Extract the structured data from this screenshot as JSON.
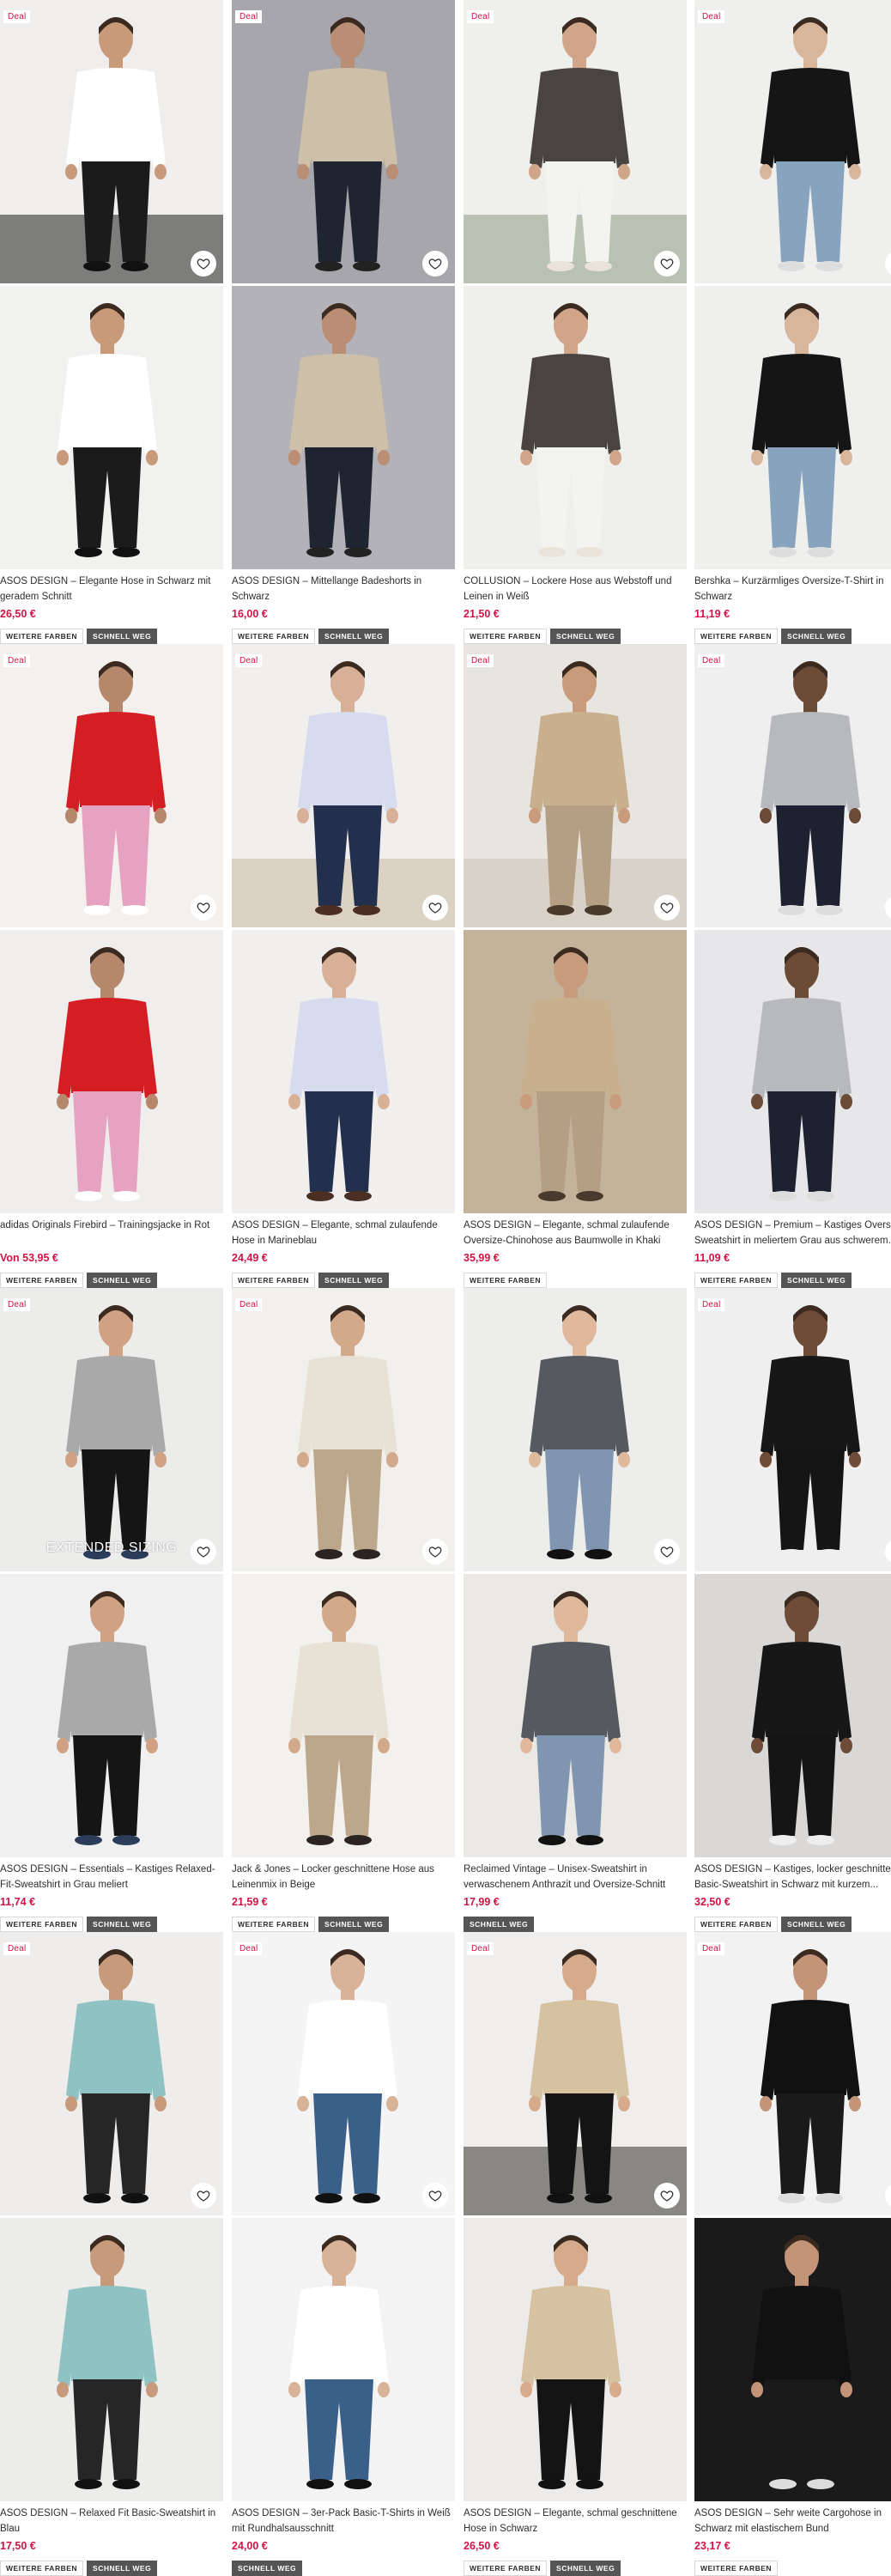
{
  "colors": {
    "deal": "#d01345",
    "price": "#d01345",
    "fast_tag_bg": "#555555"
  },
  "labels": {
    "deal": "Deal",
    "more_colors": "WEITERE FARBEN",
    "fast": "SCHNELL WEG",
    "extended_sizing": "EXTENDED SIZING"
  },
  "products": [
    {
      "name": "ASOS DESIGN – Elegante Hose in Schwarz mit geradem Schnitt",
      "price": "26,50 €",
      "deal": true,
      "more_colors": true,
      "fast": true
    },
    {
      "name": "ASOS DESIGN – Mittellange Badeshorts in Schwarz",
      "price": "16,00 €",
      "deal": true,
      "more_colors": true,
      "fast": true
    },
    {
      "name": "COLLUSION – Lockere Hose aus Webstoff und Leinen in Weiß",
      "price": "21,50 €",
      "deal": true,
      "more_colors": true,
      "fast": true
    },
    {
      "name": "Bershka – Kurzärmliges Oversize-T-Shirt in Schwarz",
      "price": "11,19 €",
      "deal": true,
      "more_colors": true,
      "fast": true
    },
    {
      "name": "adidas Originals Firebird – Trainingsjacke in Rot",
      "price": "Von 53,95 €",
      "deal": true,
      "more_colors": true,
      "fast": true
    },
    {
      "name": "ASOS DESIGN – Elegante, schmal zulaufende Hose in Marineblau",
      "price": "24,49 €",
      "deal": true,
      "more_colors": true,
      "fast": true
    },
    {
      "name": "ASOS DESIGN – Elegante, schmal zulaufende Oversize-Chinohose aus Baumwolle in Khaki",
      "price": "35,99 €",
      "deal": true,
      "more_colors": true,
      "fast": false
    },
    {
      "name": "ASOS DESIGN – Premium – Kastiges Oversize-Sweatshirt in meliertem Grau aus schwerem...",
      "price": "11,09 €",
      "deal": true,
      "more_colors": true,
      "fast": true
    },
    {
      "name": "ASOS DESIGN – Essentials – Kastiges Relaxed-Fit-Sweatshirt in Grau meliert",
      "price": "11,74 €",
      "deal": true,
      "more_colors": true,
      "fast": true,
      "extended": true
    },
    {
      "name": "Jack & Jones – Locker geschnittene Hose aus Leinenmix in Beige",
      "price": "21,59 €",
      "deal": true,
      "more_colors": true,
      "fast": true
    },
    {
      "name": "Reclaimed Vintage – Unisex-Sweatshirt in verwaschenem Anthrazit und Oversize-Schnitt",
      "price": "17,99 €",
      "deal": false,
      "more_colors": false,
      "fast": true
    },
    {
      "name": "ASOS DESIGN – Kastiges, locker geschnittenes Basic-Sweatshirt in Schwarz mit kurzem...",
      "price": "32,50 €",
      "deal": true,
      "more_colors": true,
      "fast": true
    },
    {
      "name": "ASOS DESIGN – Relaxed Fit Basic-Sweatshirt in Blau",
      "price": "17,50 €",
      "deal": true,
      "more_colors": true,
      "fast": true
    },
    {
      "name": "ASOS DESIGN – 3er-Pack Basic-T-Shirts in Weiß mit Rundhalsausschnitt",
      "price": "24,00 €",
      "deal": true,
      "more_colors": false,
      "fast": true
    },
    {
      "name": "ASOS DESIGN – Elegante, schmal geschnittene Hose in Schwarz",
      "price": "26,50 €",
      "deal": true,
      "more_colors": true,
      "fast": true
    },
    {
      "name": "ASOS DESIGN – Sehr weite Cargohose in Schwarz mit elastischem Bund",
      "price": "23,17 €",
      "deal": true,
      "more_colors": true,
      "fast": false
    }
  ]
}
